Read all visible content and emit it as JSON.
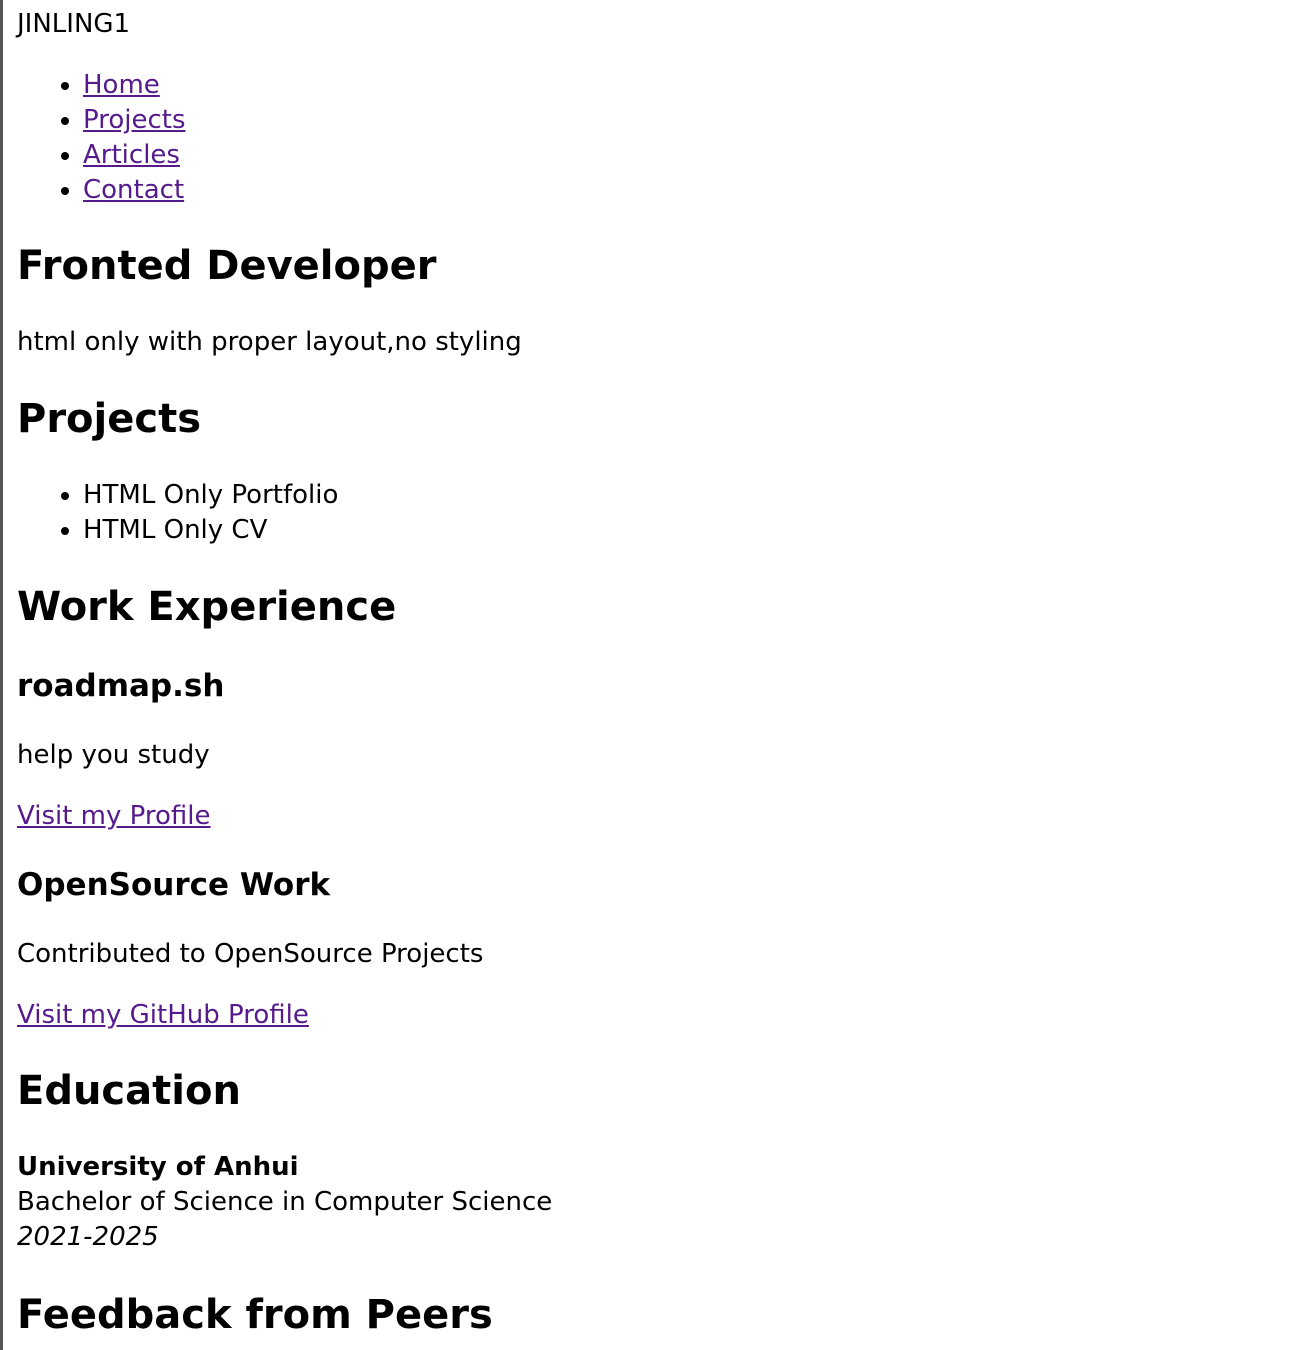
{
  "site_name": "JINLING1",
  "nav": [
    "Home",
    "Projects",
    "Articles",
    "Contact"
  ],
  "hero": {
    "title": "Fronted Developer",
    "subtitle": "html only with proper layout,no styling"
  },
  "projects": {
    "title": "Projects",
    "items": [
      "HTML Only Portfolio",
      "HTML Only CV"
    ]
  },
  "work": {
    "title": "Work Experience",
    "entries": [
      {
        "name": "roadmap.sh",
        "description": "help you study",
        "link": "Visit my Profile"
      },
      {
        "name": "OpenSource Work",
        "description": "Contributed to OpenSource Projects",
        "link": "Visit my GitHub Profile"
      }
    ]
  },
  "education": {
    "title": "Education",
    "school": "University of Anhui",
    "degree": "Bachelor of Science in Computer Science",
    "years": "2021-2025"
  },
  "feedback": {
    "title": "Feedback from Peers"
  },
  "colors": {
    "link": "#551a8b",
    "text": "#000000",
    "background": "#ffffff"
  }
}
